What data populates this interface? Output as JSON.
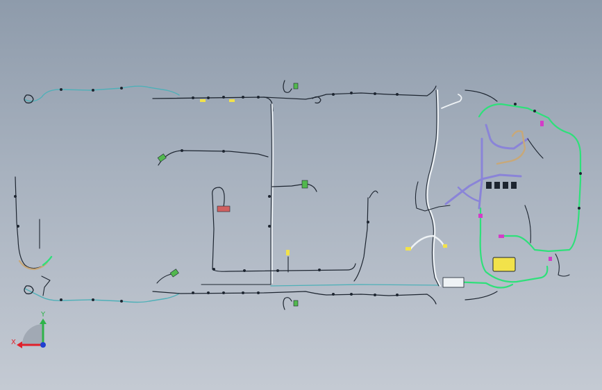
{
  "triad": {
    "x_label": "X",
    "y_label": "Y",
    "x_color": "#e0202a",
    "y_color": "#2fb34a",
    "z_color": "#2040d0"
  },
  "colors": {
    "wire_dark": "#1d2530",
    "wire_teal": "#4fb0b8",
    "wire_white": "#eef2f5",
    "wire_green": "#2ee07a",
    "wire_purple": "#8a84d8",
    "wire_tan": "#c8a878",
    "connector_green": "#52b84e",
    "connector_yellow": "#f2e24a",
    "connector_red": "#d06060",
    "connector_magenta": "#d43cc8"
  }
}
